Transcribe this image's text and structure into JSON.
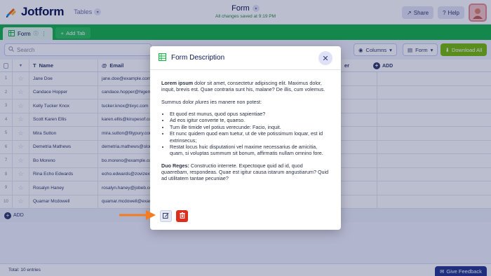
{
  "header": {
    "logo_text": "Jotform",
    "product_label": "Tables",
    "form_title": "Form",
    "saved_status": "All changes saved at 9:19 PM",
    "share_label": "Share",
    "help_label": "Help"
  },
  "tabs": {
    "active_label": "Form",
    "add_label": "Add Tab"
  },
  "toolbar": {
    "search_placeholder": "Search",
    "columns_label": "Columns",
    "form_label": "Form",
    "download_label": "Download All"
  },
  "table": {
    "headers": {
      "name": "Name",
      "email": "Email",
      "other": "er",
      "add_column": "ADD"
    },
    "rows": [
      {
        "num": "1",
        "name": "Jane Doe",
        "email": "jane.doe@example.com"
      },
      {
        "num": "2",
        "name": "Candace Hopper",
        "email": "candace.hopper@higemam.com"
      },
      {
        "num": "3",
        "name": "Kelly Tucker Knox",
        "email": "tucker.knox@tixyc.com"
      },
      {
        "num": "4",
        "name": "Scott Karen Ellis",
        "email": "karen.ellis@kirupesof.com"
      },
      {
        "num": "5",
        "name": "Mira Sutton",
        "email": "mira.sutton@fitypury.com"
      },
      {
        "num": "6",
        "name": "Demetria Mathews",
        "email": "demetria.mathews@slomec.com"
      },
      {
        "num": "7",
        "name": "Bo Moreno",
        "email": "bo.moreno@example.com"
      },
      {
        "num": "8",
        "name": "Rina Echo Edwards",
        "email": "echo.edwards@zovizexo.com"
      },
      {
        "num": "9",
        "name": "Rosalyn Haney",
        "email": "rosalyn.haney@jobeb.com"
      },
      {
        "num": "10",
        "name": "Quamar Mcdowell",
        "email": "quamar.mcdowell@example.com"
      }
    ],
    "add_row_label": "ADD"
  },
  "footer": {
    "total_label": "Total: 10 entries",
    "feedback_label": "Give Feedback"
  },
  "modal": {
    "title": "Form Description",
    "p1_bold": "Lorem ipsum",
    "p1_rest": " dolor sit amet, consectetur adipiscing elit. Maximus dolor, inquit, brevis est. Quae contraria sunt his, malane? De illis, cum volemus.",
    "p2_start": "Summus dolor ",
    "p2_em": "plures",
    "p2_end": " ies manere non potest:",
    "bullets": [
      "Et quod est munus, quod opus sapientiae?",
      "Ad eos igitur converte te, quaeso.",
      "Tum ille timide vel potius verecunde: Facio, inquit.",
      "Et nunc quidem quod eam tuetur, ut de vite potissimum loquar, est id extrinsecus;",
      "Restat locus huic disputationi vel maxime necessarius de amicitia, quam, si voluptas summum sit bonum, affirmatis nullam omnino fore."
    ],
    "p3_bold": "Duo Reges:",
    "p3_mid": " Constructio interrete. Expectoque quid ad id, quod ",
    "p3_em": "quaerebam",
    "p3_end": ", respondeas. Quae est igitur causa istarum angustiarum? Quid ad utilitatem tantae pecuniae?"
  },
  "colors": {
    "accent_green": "#18b34a",
    "download_green": "#78bb07",
    "delete_red": "#dc2e1f",
    "arrow_orange": "#f47b20",
    "navy": "#0a1551"
  },
  "icons": [
    "jotform-logo-icon",
    "chevron-down-icon",
    "share-icon",
    "help-icon",
    "table-icon",
    "info-icon",
    "plus-icon",
    "search-icon",
    "eye-icon",
    "form-icon",
    "download-icon",
    "star-icon",
    "close-icon",
    "edit-icon",
    "trash-icon",
    "arrow-right-icon",
    "feedback-icon"
  ]
}
